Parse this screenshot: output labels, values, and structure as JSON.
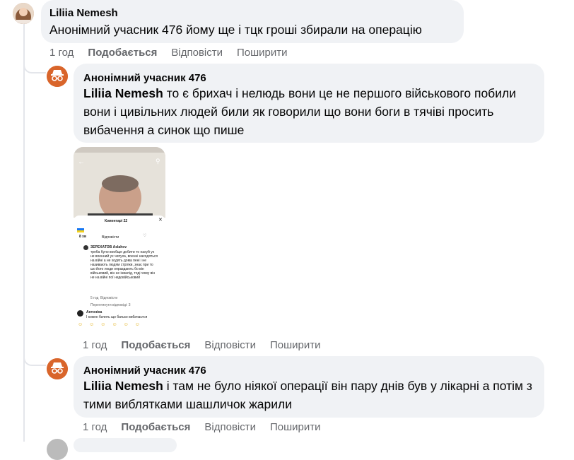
{
  "comments": [
    {
      "author": "Liliia Nemesh",
      "text": "Анонімний учасник 476 йому ще і тцк гроші збирали на операцію",
      "time": "1 год",
      "like": "Подобається",
      "reply": "Відповісти",
      "share": "Поширити"
    },
    {
      "author": "Анонімний учасник 476",
      "mention": "Liliia Nemesh",
      "text": " то є брихач і нелюдь вони це не першого військового побили вони і цивільних людей били як говорили що вони боги в тячіві просить вибачення а синок що пише",
      "time": "1 год",
      "like": "Подобається",
      "reply": "Відповісти",
      "share": "Поширити"
    },
    {
      "author": "Анонімний учасник 476",
      "mention": "Liliia Nemesh",
      "text": " і там не було ніякої операції він пару днів був у лікарні а потім з тими виблятками шашличок жарили",
      "time": "1 год",
      "like": "Подобається",
      "reply": "Відповісти",
      "share": "Поширити"
    }
  ],
  "screenshot": {
    "sheet_title": "Коментарі 22",
    "top_comment_user": "8 хв",
    "top_comment_reply": "Відповісти",
    "reply_user": "ЗЕРЕХАТОВ Aslahov",
    "reply_text": "треба було вообще добити то нахуй ух не военний ух чепуха, военні находяться на війні а не ходять дома пені і не називають людям стрілки, знає при то шо його люди опраздають бо він військовий, він не інвалід, тоді чому він не на війні пої недовійськовий",
    "reply_meta": "5 год",
    "reply_meta2": "Відповісти",
    "more_replies": "Переглянути відповіді: 3",
    "bottom_user": "Антоніна",
    "bottom_text": "І кожен бачить що батько вибачаєтся",
    "accent": "#1877f2",
    "icons": [
      "back-arrow-icon",
      "search-icon",
      "close-icon",
      "heart-icon"
    ]
  },
  "colors": {
    "bubble": "#f0f2f5",
    "meta": "#65676b",
    "anon_avatar": "#d9652b"
  }
}
